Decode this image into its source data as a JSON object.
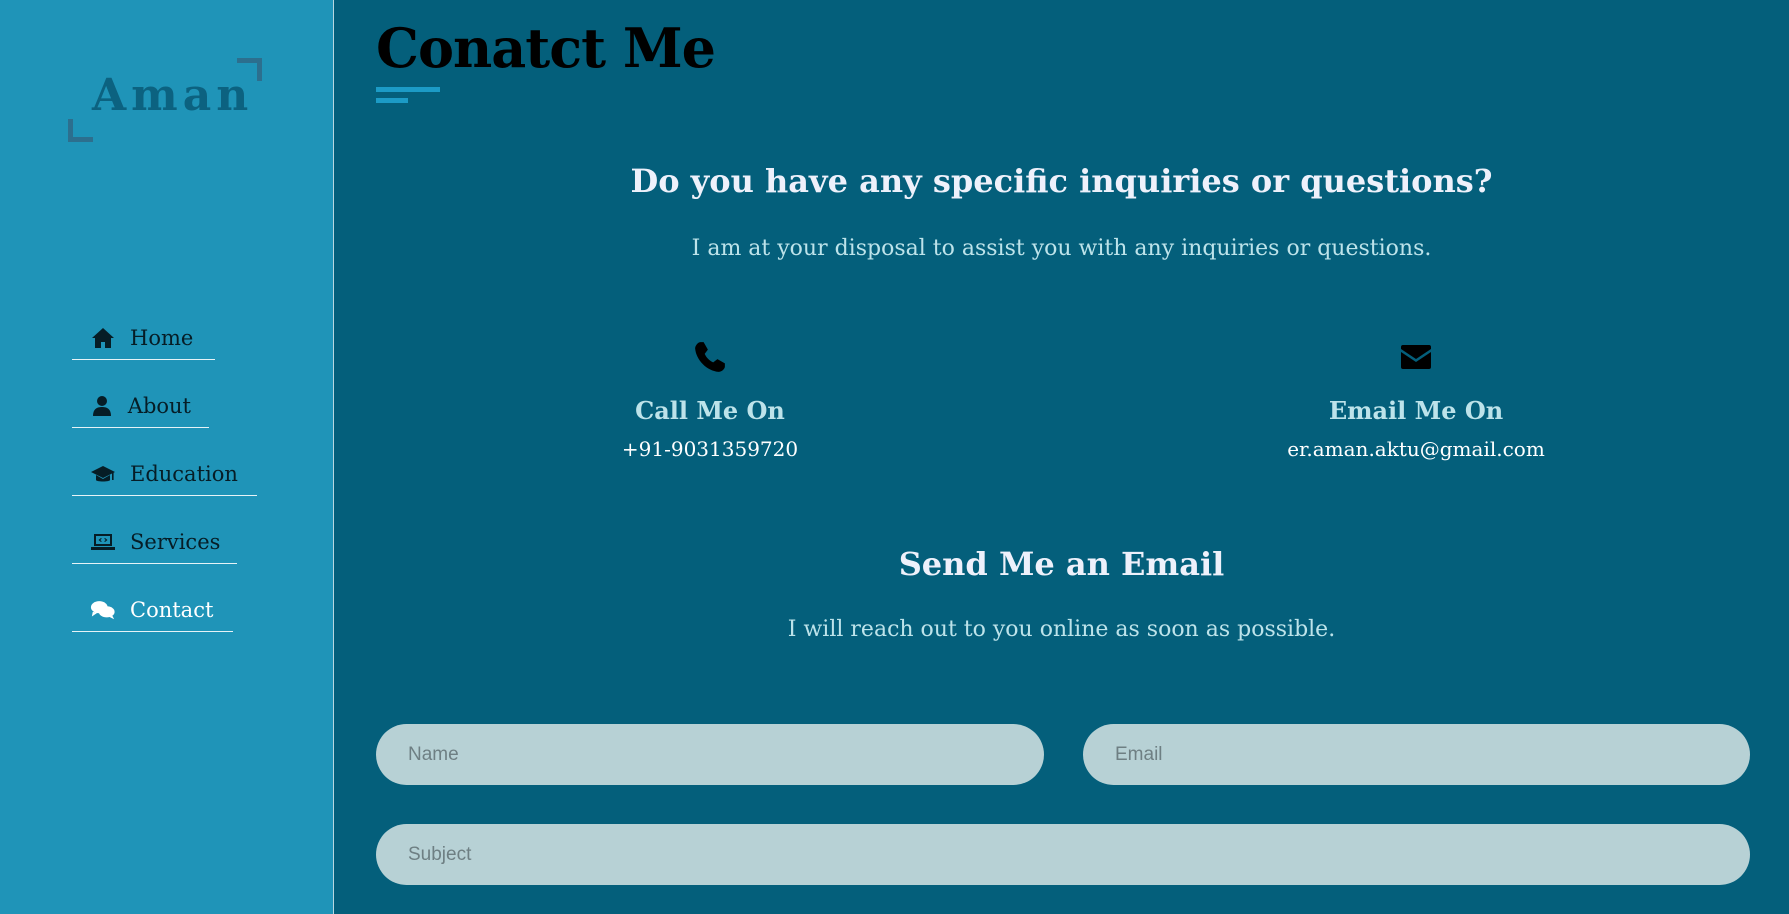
{
  "sidebar": {
    "logo_text": "Aman",
    "items": [
      {
        "label": "Home",
        "icon": "home-icon"
      },
      {
        "label": "About",
        "icon": "user-icon"
      },
      {
        "label": "Education",
        "icon": "graduation-cap-icon"
      },
      {
        "label": "Services",
        "icon": "laptop-code-icon"
      },
      {
        "label": "Contact",
        "icon": "comments-icon",
        "active": true
      }
    ]
  },
  "main": {
    "title": "Conatct Me",
    "inquiry_title": "Do you have any specific inquiries or questions?",
    "inquiry_sub": "I am at your disposal to assist you with any inquiries or questions.",
    "call": {
      "label": "Call Me On",
      "value": "+91-9031359720",
      "icon": "phone-icon"
    },
    "email": {
      "label": "Email Me On",
      "value": "er.aman.aktu@gmail.com",
      "icon": "envelope-icon"
    },
    "send_title": "Send Me an Email",
    "send_sub": "I will reach out to you online as soon as possible.",
    "form": {
      "name_placeholder": "Name",
      "email_placeholder": "Email",
      "subject_placeholder": "Subject"
    }
  },
  "colors": {
    "sidebar_bg": "#1f94b8",
    "main_bg": "#045f7b",
    "accent": "#1c9bc6",
    "input_bg": "#b7d1d5"
  }
}
